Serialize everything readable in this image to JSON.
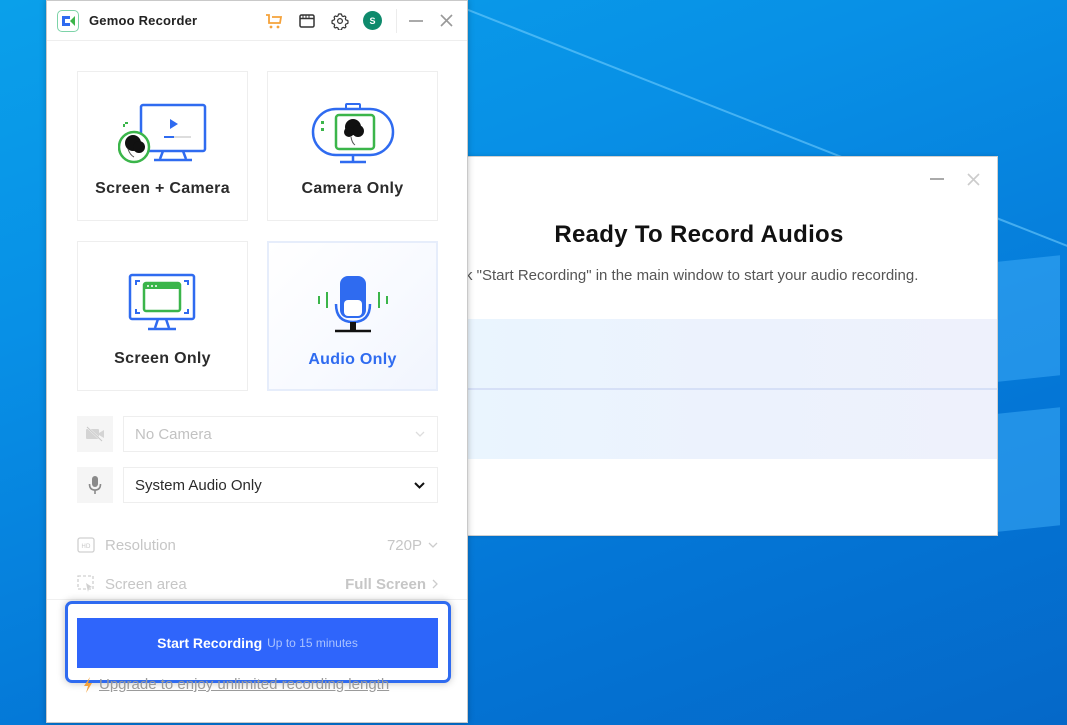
{
  "app": {
    "title": "Gemoo Recorder",
    "avatar_initial": "S",
    "icons": [
      "cart-icon",
      "browser-window-icon",
      "gear-icon",
      "minimize-icon",
      "close-icon"
    ]
  },
  "modes": [
    {
      "label": "Screen + Camera",
      "icon": "screen-camera-icon",
      "selected": false
    },
    {
      "label": "Camera Only",
      "icon": "webcam-icon",
      "selected": false
    },
    {
      "label": "Screen Only",
      "icon": "screen-icon",
      "selected": false
    },
    {
      "label": "Audio Only",
      "icon": "microphone-icon",
      "selected": true
    }
  ],
  "devices": {
    "camera": {
      "value": "No Camera",
      "disabled": true
    },
    "audio": {
      "value": "System Audio Only",
      "disabled": false
    }
  },
  "options": {
    "resolution": {
      "label": "Resolution",
      "value": "720P"
    },
    "screen_area": {
      "label": "Screen area",
      "value": "Full Screen"
    }
  },
  "start": {
    "label": "Start Recording",
    "limit": "Up to 15 minutes"
  },
  "upgrade_link": "Upgrade to enjoy unlimited recording length",
  "dialog": {
    "title": "Ready To Record Audios",
    "text": "k \"Start Recording\" in the main window to start your audio recording."
  },
  "colors": {
    "accent": "#2f65fb",
    "selected_text": "#2f6bf0",
    "green": "#3bb54a",
    "avatar": "#0e8a6c",
    "cart": "#f5a23a"
  }
}
